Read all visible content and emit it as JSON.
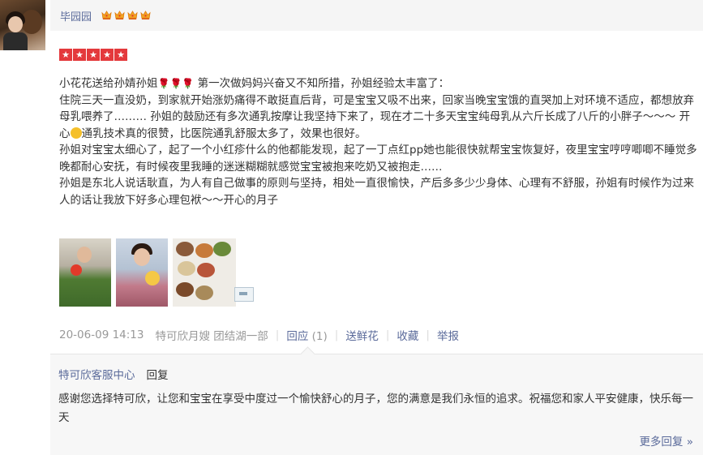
{
  "reviewer": {
    "name": "毕园园",
    "crown_count": 4
  },
  "rating": {
    "stars": 5,
    "star_glyph": "★"
  },
  "review": {
    "p1_a": "小花花送给孙婧孙姐",
    "p1_flowers": "🌹🌹🌹",
    "p1_b": " 第一次做妈妈兴奋又不知所措，孙姐经验太丰富了：",
    "p2": "住院三天一直没奶，到家就开始涨奶痛得不敢挺直后背，可是宝宝又吸不出来，回家当晚宝宝饿的直哭加上对环境不适应，都想放弃母乳喂养了……… 孙姐的鼓励还有多次通乳按摩让我坚持下来了，现在才二十多天宝宝纯母乳从六斤长成了八斤的小胖子～～～ 开心",
    "p2_b": "通乳技术真的很赞，比医院通乳舒服太多了，效果也很好。",
    "p3": "孙姐对宝宝太细心了，起了一个小红疹什么的他都能发现，起了一丁点红pp她也能很快就帮宝宝恢复好，夜里宝宝哼哼唧唧不睡觉多晚都耐心安抚，有时候夜里我睡的迷迷糊糊就感觉宝宝被抱来吃奶又被抱走……",
    "p4": "孙姐是东北人说话耿直，为人有自己做事的原则与坚持，相处一直很愉快，产后多多少少身体、心理有不舒服，孙姐有时候作为过来人的话让我放下好多心理包袱～～开心的月子"
  },
  "meta": {
    "date": "20-06-09 14:13",
    "nanny": "特可欣月嫂 团结湖一部",
    "reply_label": "回应",
    "reply_count": "(1)",
    "flower_label": "送鲜花",
    "collect_label": "收藏",
    "report_label": "举报",
    "separator": "|"
  },
  "reply": {
    "name": "特可欣客服中心",
    "word": "回复",
    "text": "感谢您选择特可欣，让您和宝宝在享受中度过一个愉快舒心的月子，您的满意是我们永恒的追求。祝福您和家人平安健康，快乐每一天",
    "more": "更多回复 »"
  },
  "colors": {
    "link": "#5a6a9a",
    "star_bg": "#e4393c",
    "muted": "#999999"
  }
}
